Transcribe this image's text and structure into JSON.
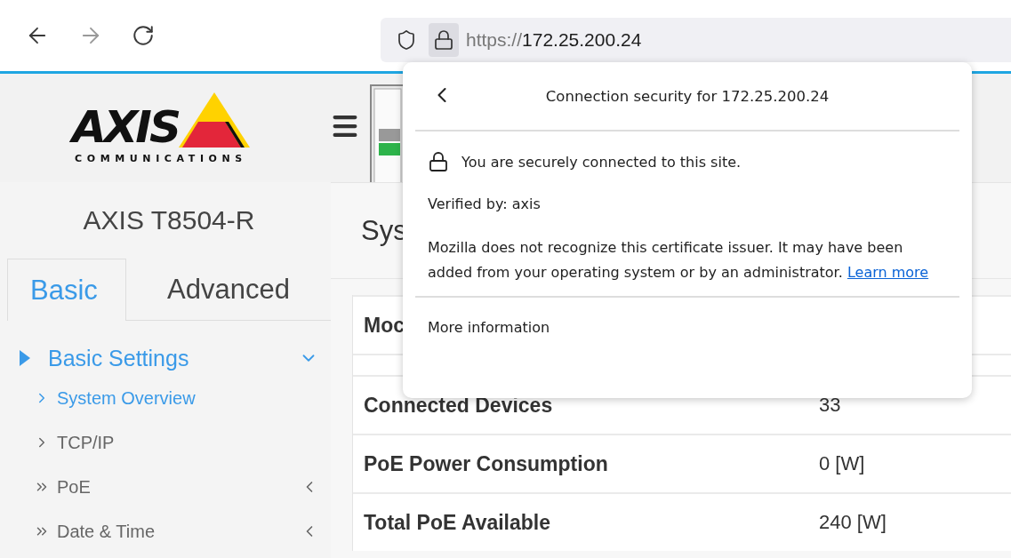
{
  "browser": {
    "url_scheme": "https://",
    "url_host": "172.25.200.24"
  },
  "logo": {
    "wordmark": "AXIS",
    "tagline": "COMMUNICATIONS"
  },
  "device": {
    "model": "AXIS T8504-R"
  },
  "tabs": [
    {
      "label": "Basic",
      "selected": true
    },
    {
      "label": "Advanced",
      "selected": false
    }
  ],
  "menu": [
    {
      "label": "Basic Settings",
      "expanded": true,
      "children": [
        {
          "label": "System Overview",
          "kind": "page",
          "selected": true
        },
        {
          "label": "TCP/IP",
          "kind": "page",
          "selected": false
        },
        {
          "label": "PoE",
          "kind": "group",
          "selected": false,
          "expanded": false
        },
        {
          "label": "Date & Time",
          "kind": "group",
          "selected": false,
          "expanded": false
        }
      ]
    }
  ],
  "page_title": "Sys",
  "table": {
    "rows": [
      {
        "kind": "item",
        "label": "Moc"
      },
      {
        "kind": "blank"
      },
      {
        "kind": "item",
        "label": "Connected Devices",
        "value": "33"
      },
      {
        "kind": "item",
        "label": "PoE Power Consumption",
        "value": "0 [W]"
      },
      {
        "kind": "item",
        "label": "Total PoE Available",
        "value": "240 [W]"
      }
    ]
  },
  "popup": {
    "title": "Connection security for 172.25.200.24",
    "status": "You are securely connected to this site.",
    "verified": "Verified by: axis",
    "message": "Mozilla does not recognize this certificate issuer. It may have been added from your operating system or by an administrator.",
    "link": "Learn more",
    "more": "More information"
  }
}
